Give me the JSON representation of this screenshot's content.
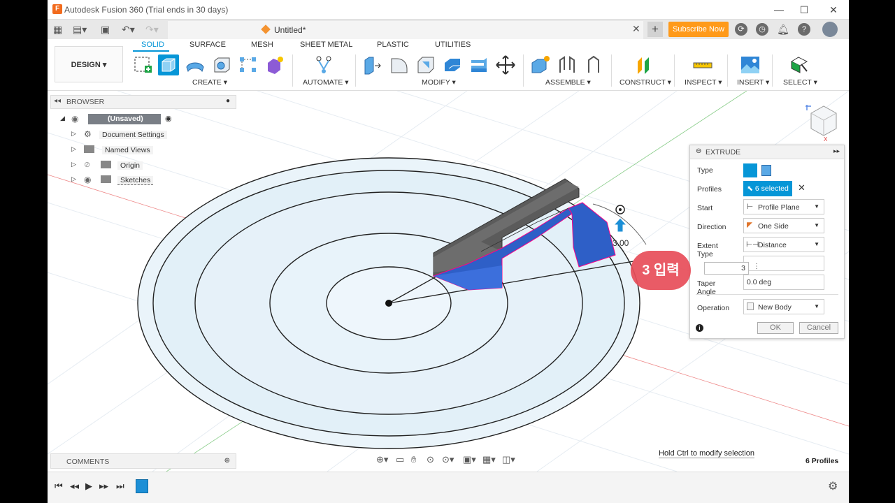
{
  "window": {
    "title": "Autodesk Fusion 360 (Trial ends in 30 days)",
    "logo_letter": "F"
  },
  "window_controls": {
    "minimize": "—",
    "maximize": "☐",
    "close": "✕"
  },
  "document": {
    "title": "Untitled*",
    "close": "✕",
    "new_tab": "+"
  },
  "subscribe_label": "Subscribe Now",
  "workspace": {
    "label": "DESIGN ▾"
  },
  "tabs": [
    "SOLID",
    "SURFACE",
    "MESH",
    "SHEET METAL",
    "PLASTIC",
    "UTILITIES"
  ],
  "groups": [
    "CREATE ▾",
    "AUTOMATE ▾",
    "MODIFY ▾",
    "ASSEMBLE ▾",
    "CONSTRUCT ▾",
    "INSPECT ▾",
    "INSERT ▾",
    "SELECT ▾"
  ],
  "browser": {
    "title": "BROWSER",
    "root": "(Unsaved)",
    "items": [
      "Document Settings",
      "Named Views",
      "Origin",
      "Sketches"
    ]
  },
  "comments": {
    "title": "COMMENTS"
  },
  "extrude": {
    "title": "EXTRUDE",
    "labels": {
      "type": "Type",
      "profiles": "Profiles",
      "start": "Start",
      "direction": "Direction",
      "extent_type": "Extent Type",
      "taper": "Taper Angle",
      "operation": "Operation"
    },
    "profiles_value": "6 selected",
    "start_value": "Profile Plane",
    "direction_value": "One Side",
    "extent_value": "Distance",
    "distance_value": "3",
    "taper_value": "0.0 deg",
    "operation_value": "New Body",
    "ok": "OK",
    "cancel": "Cancel"
  },
  "annotation": "3 입력",
  "dimension_label": "3.00",
  "status": {
    "hint": "Hold Ctrl to modify selection",
    "profiles": "6 Profiles"
  },
  "colors": {
    "accent": "#0696d7",
    "subscribe": "#ff9a1a",
    "callout": "#e84f5b",
    "profile_fill": "#2e5fc7",
    "body": "#6a6a6a"
  }
}
